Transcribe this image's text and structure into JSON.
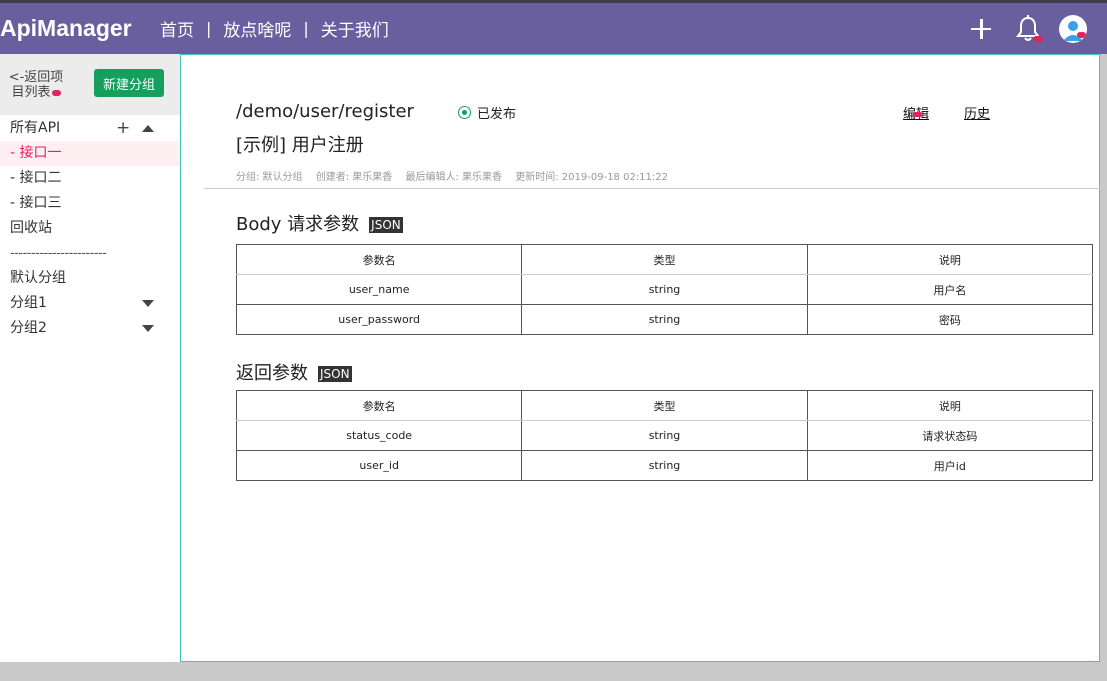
{
  "navbar": {
    "brand": "ApiManager",
    "links": [
      "首页",
      "放点啥呢",
      "关于我们"
    ],
    "separator": "|",
    "icons": [
      "plus-icon",
      "bell-icon",
      "avatar-icon"
    ],
    "bg_color": "#6a5f9e"
  },
  "sidebar": {
    "back_label": "<-返回项目列表",
    "new_group_label": "新建分组",
    "all_api_label": "所有API",
    "all_api_plus": "+",
    "interfaces": [
      "- 接口一",
      "- 接口二",
      "- 接口三"
    ],
    "recycle_label": "回收站",
    "divider": "-----------------------",
    "default_group": "默认分组",
    "groups": [
      "分组1",
      "分组2"
    ]
  },
  "api": {
    "path": "/demo/user/register",
    "status": "已发布",
    "edit_label": "编辑",
    "history_label": "历史",
    "title": "[示例] 用户注册",
    "meta": {
      "group": "分组: 默认分组",
      "creator": "创建者: 果乐果香",
      "last_editor": "最后编辑人: 果乐果香",
      "updated": "更新时间: 2019-09-18 02:11:22"
    }
  },
  "body_params": {
    "title": "Body 请求参数",
    "badge": "JSON",
    "headers": [
      "参数名",
      "类型",
      "说明"
    ],
    "rows": [
      [
        "user_name",
        "string",
        "用户名"
      ],
      [
        "user_password",
        "string",
        "密码"
      ]
    ]
  },
  "return_params": {
    "title": "返回参数",
    "badge": "JSON",
    "headers": [
      "参数名",
      "类型",
      "说明"
    ],
    "rows": [
      [
        "status_code",
        "string",
        "请求状态码"
      ],
      [
        "user_id",
        "string",
        "用户id"
      ]
    ]
  },
  "colors": {
    "accent_green": "#14a05c",
    "active_pink": "#e0245e",
    "main_border": "#3ec6b8"
  }
}
